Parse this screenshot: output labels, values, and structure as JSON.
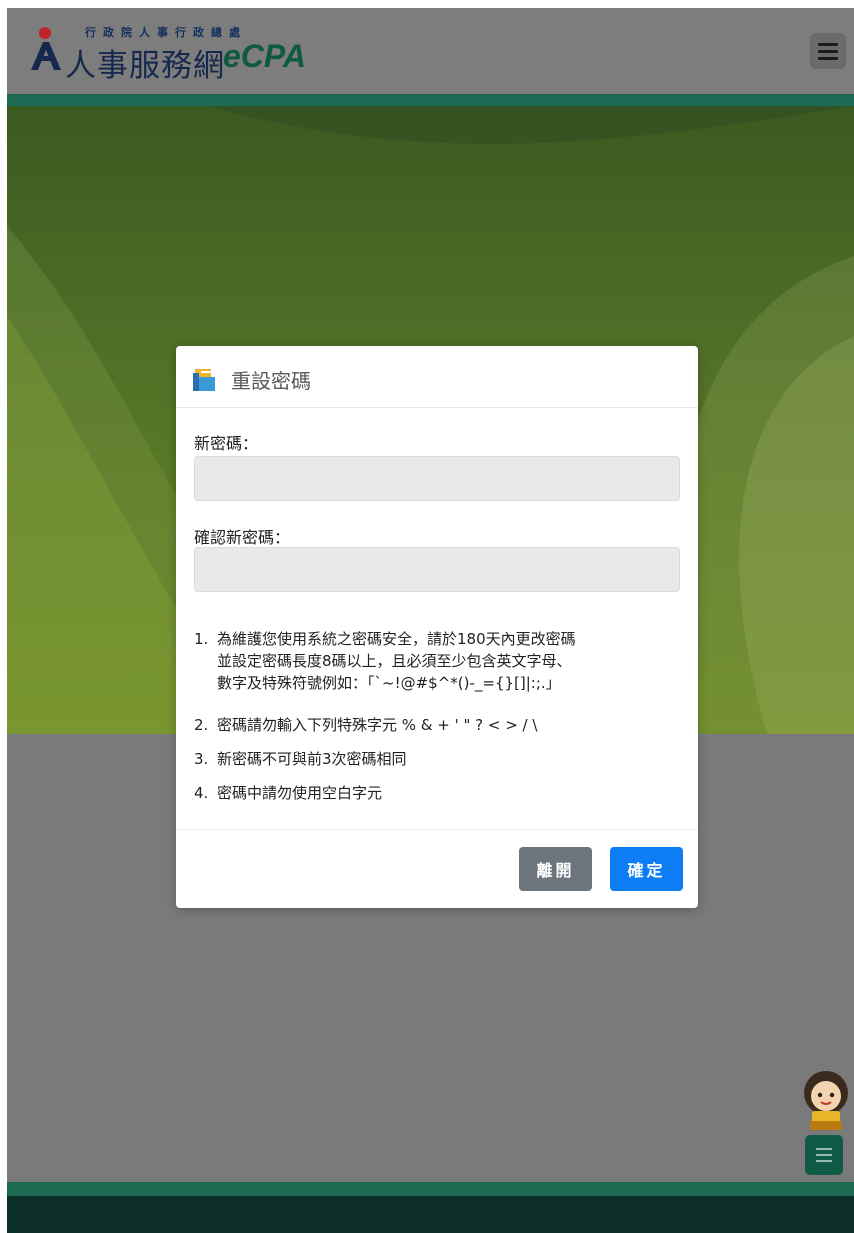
{
  "header": {
    "logo_subtitle": "行政院人事行政總處",
    "logo_title": "人事服務網",
    "logo_brand": "eCPA",
    "menu_icon": "hamburger-menu-icon"
  },
  "dialog": {
    "title": "重設密碼",
    "title_icon": "document-folder-icon",
    "new_password_label": "新密碼：",
    "confirm_password_label": "確認新密碼：",
    "new_password_value": "",
    "confirm_password_value": "",
    "rules": [
      {
        "num": "1.",
        "text": "為維護您使用系統之密碼安全，請於180天內更改密碼\n並設定密碼長度8碼以上，且必須至少包含英文字母、\n數字及特殊符號例如：「`~!@#$^*()-_={}[]|:;.」"
      },
      {
        "num": "2.",
        "text": "密碼請勿輸入下列特殊字元 % & + ' \" ? < > / \\"
      },
      {
        "num": "3.",
        "text": "新密碼不可與前3次密碼相同"
      },
      {
        "num": "4.",
        "text": "密碼中請勿使用空白字元"
      }
    ],
    "leave_button": "離開",
    "confirm_button": "確定"
  },
  "floating": {
    "mascot_icon": "mascot-character-icon",
    "menu_icon": "hamburger-menu-icon"
  },
  "colors": {
    "header_stripe": "#1f6a55",
    "footer": "#0c3029",
    "primary_button": "#0d7df5",
    "secondary_button": "#6c757d"
  }
}
